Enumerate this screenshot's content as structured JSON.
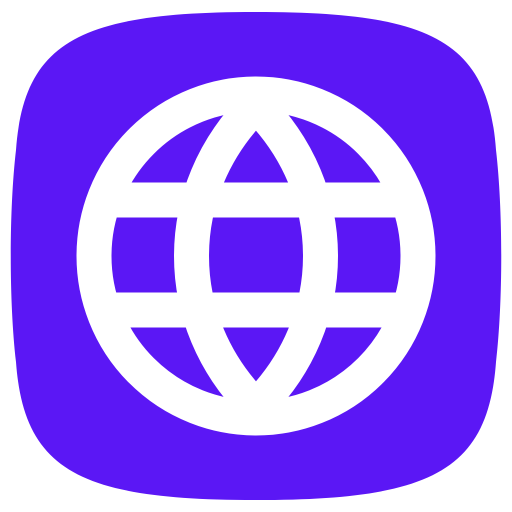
{
  "icon": {
    "name": "globe-icon",
    "background_color": "#5B17F5",
    "glyph_color": "#FFFFFF"
  }
}
